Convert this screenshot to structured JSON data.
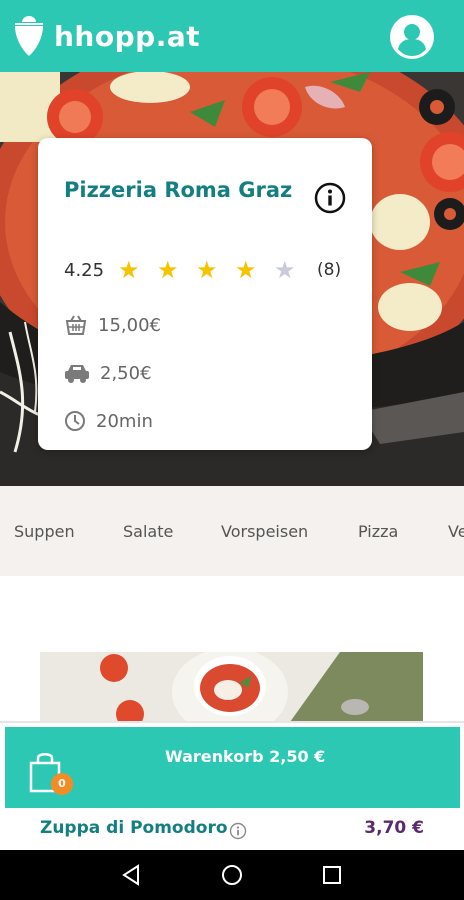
{
  "header": {
    "app_name": "hhopp.at",
    "logo_icon": "hhopp-logo-icon",
    "profile_icon": "user-profile-icon"
  },
  "restaurant": {
    "name": "Pizzeria Roma Graz",
    "rating": "4.25",
    "rating_stars": 4.25,
    "rating_count": "(8)",
    "min_order": "15,00€",
    "delivery_fee": "2,50€",
    "delivery_time": "20min"
  },
  "categories": [
    "Suppen",
    "Salate",
    "Vorspeisen",
    "Pizza",
    "Ve"
  ],
  "cart": {
    "label": "Warenkorb 2,50 €",
    "badge": "0"
  },
  "menu_item": {
    "name": "Zuppa di Pomodoro",
    "price": "3,70 €"
  },
  "colors": {
    "brand_teal": "#2cc8b4",
    "title_teal": "#137f82",
    "star_gold": "#f5c400",
    "badge_orange": "#f48c25",
    "price_purple": "#5b2a6e"
  }
}
